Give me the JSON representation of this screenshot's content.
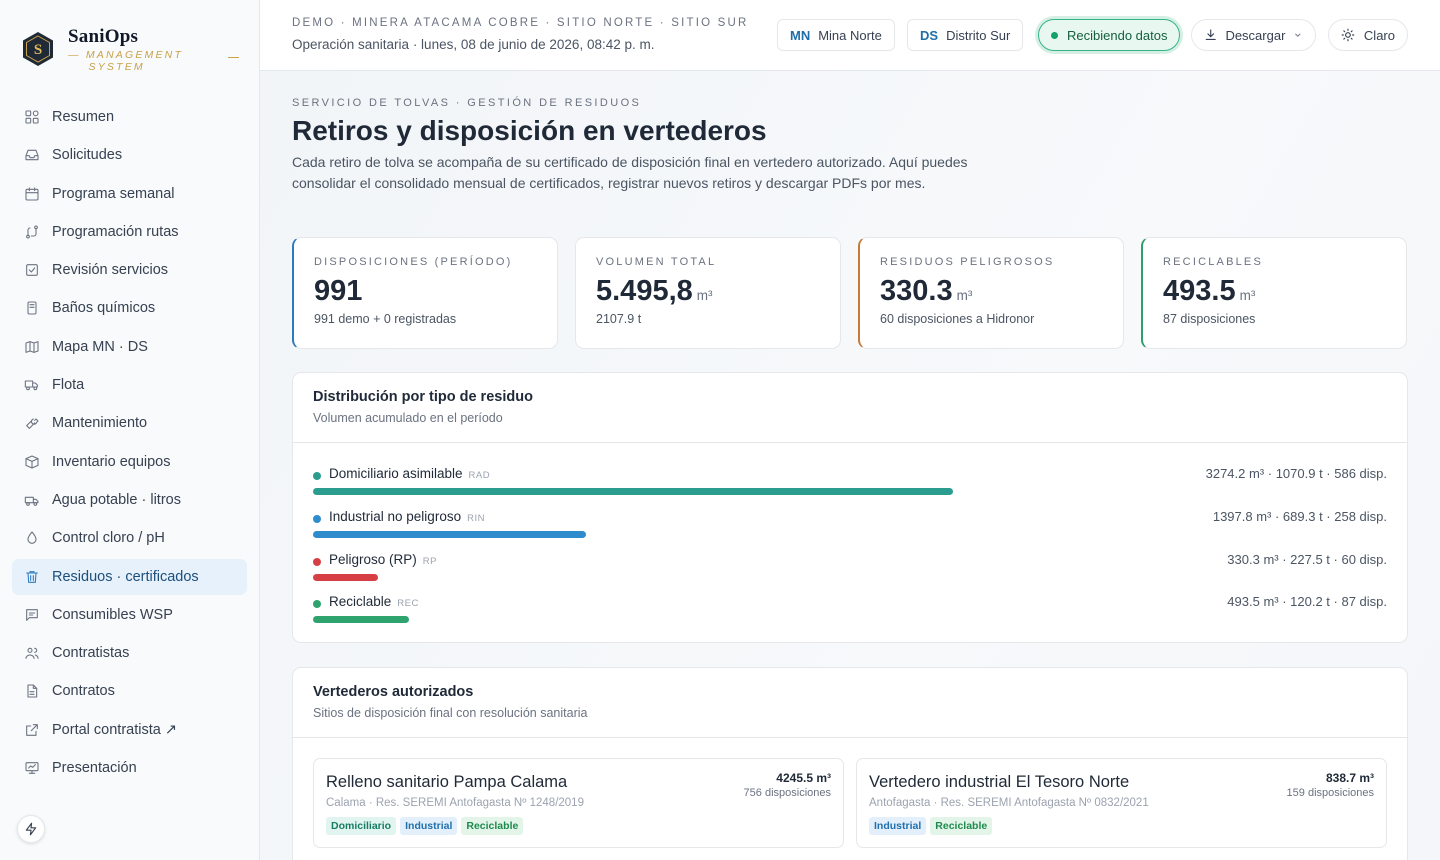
{
  "brand": {
    "name": "SaniOps",
    "sub1": "Management",
    "sub2": "System"
  },
  "nav": [
    {
      "label": "Resumen",
      "icon": "grid-icon"
    },
    {
      "label": "Solicitudes",
      "icon": "inbox-icon"
    },
    {
      "label": "Programa semanal",
      "icon": "calendar-icon"
    },
    {
      "label": "Programación rutas",
      "icon": "route-icon"
    },
    {
      "label": "Revisión servicios",
      "icon": "checkbox-icon"
    },
    {
      "label": "Baños químicos",
      "icon": "toilet-icon"
    },
    {
      "label": "Mapa MN · DS",
      "icon": "map-icon"
    },
    {
      "label": "Flota",
      "icon": "truck-icon"
    },
    {
      "label": "Mantenimiento",
      "icon": "wrench-icon"
    },
    {
      "label": "Inventario equipos",
      "icon": "box-icon"
    },
    {
      "label": "Agua potable · litros",
      "icon": "water-truck-icon"
    },
    {
      "label": "Control cloro / pH",
      "icon": "droplet-icon"
    },
    {
      "label": "Residuos · certificados",
      "icon": "trash-icon"
    },
    {
      "label": "Consumibles WSP",
      "icon": "message-icon"
    },
    {
      "label": "Contratistas",
      "icon": "users-icon"
    },
    {
      "label": "Contratos",
      "icon": "file-icon"
    },
    {
      "label": "Portal contratista ↗",
      "icon": "external-link-icon"
    },
    {
      "label": "Presentación",
      "icon": "presentation-icon"
    }
  ],
  "active_nav": 12,
  "header": {
    "crumbs": "Demo · Minera Atacama Cobre · Sitio Norte · Sitio Sur",
    "subtitle": "Operación sanitaria · lunes, 08 de junio de 2026, 08:42 p. m.",
    "site1": {
      "code": "MN",
      "label": "Mina Norte"
    },
    "site2": {
      "code": "DS",
      "label": "Distrito Sur"
    },
    "live": "Recibiendo datos",
    "download": "Descargar",
    "theme": "Claro"
  },
  "page": {
    "eyebrow": "Servicio de tolvas · Gestión de residuos",
    "title": "Retiros y disposición en vertederos",
    "description": "Cada retiro de tolva se acompaña de su certificado de disposición final en vertedero autorizado. Aquí puedes consolidar el consolidado mensual de certificados, registrar nuevos retiros y descargar PDFs por mes."
  },
  "kpis": [
    {
      "label": "Disposiciones (período)",
      "value": "991",
      "unit": "",
      "note": "991 demo + 0 registradas",
      "color": "#2b7bbf"
    },
    {
      "label": "Volumen total",
      "value": "5.495,8",
      "unit": "m³",
      "note": "2107.9 t",
      "color": ""
    },
    {
      "label": "Residuos peligrosos",
      "value": "330.3",
      "unit": "m³",
      "note": "60 disposiciones a Hidronor",
      "color": "#c77a3a"
    },
    {
      "label": "Reciclables",
      "value": "493.5",
      "unit": "m³",
      "note": "87 disposiciones",
      "color": "#2e9e6a"
    }
  ],
  "distribution": {
    "title": "Distribución por tipo de residuo",
    "subtitle": "Volumen acumulado en el período",
    "items": [
      {
        "name": "Domiciliario asimilable",
        "code": "RAD",
        "stats": "3274.2 m³ · 1070.9 t · 586 disp.",
        "volume": 3274.2,
        "color": "#2a9d8f"
      },
      {
        "name": "Industrial no peligroso",
        "code": "RIN",
        "stats": "1397.8 m³ · 689.3 t · 258 disp.",
        "volume": 1397.8,
        "color": "#2e8ccc"
      },
      {
        "name": "Peligroso (RP)",
        "code": "RP",
        "stats": "330.3 m³ · 227.5 t · 60 disp.",
        "volume": 330.3,
        "color": "#d64045"
      },
      {
        "name": "Reciclable",
        "code": "REC",
        "stats": "493.5 m³ · 120.2 t · 87 disp.",
        "volume": 493.5,
        "color": "#2ea36e"
      }
    ]
  },
  "landfills": {
    "title": "Vertederos autorizados",
    "subtitle": "Sitios de disposición final con resolución sanitaria",
    "sites": [
      {
        "name": "Relleno sanitario Pampa Calama",
        "meta": "Calama · Res. SEREMI Antofagasta Nº 1248/2019",
        "volume": "4245.5 m³",
        "count": "756 disposiciones",
        "tags": [
          "Domiciliario",
          "Industrial",
          "Reciclable"
        ]
      },
      {
        "name": "Vertedero industrial El Tesoro Norte",
        "meta": "Antofagasta · Res. SEREMI Antofagasta Nº 0832/2021",
        "volume": "838.7 m³",
        "count": "159 disposiciones",
        "tags": [
          "Industrial",
          "Reciclable"
        ]
      }
    ]
  }
}
